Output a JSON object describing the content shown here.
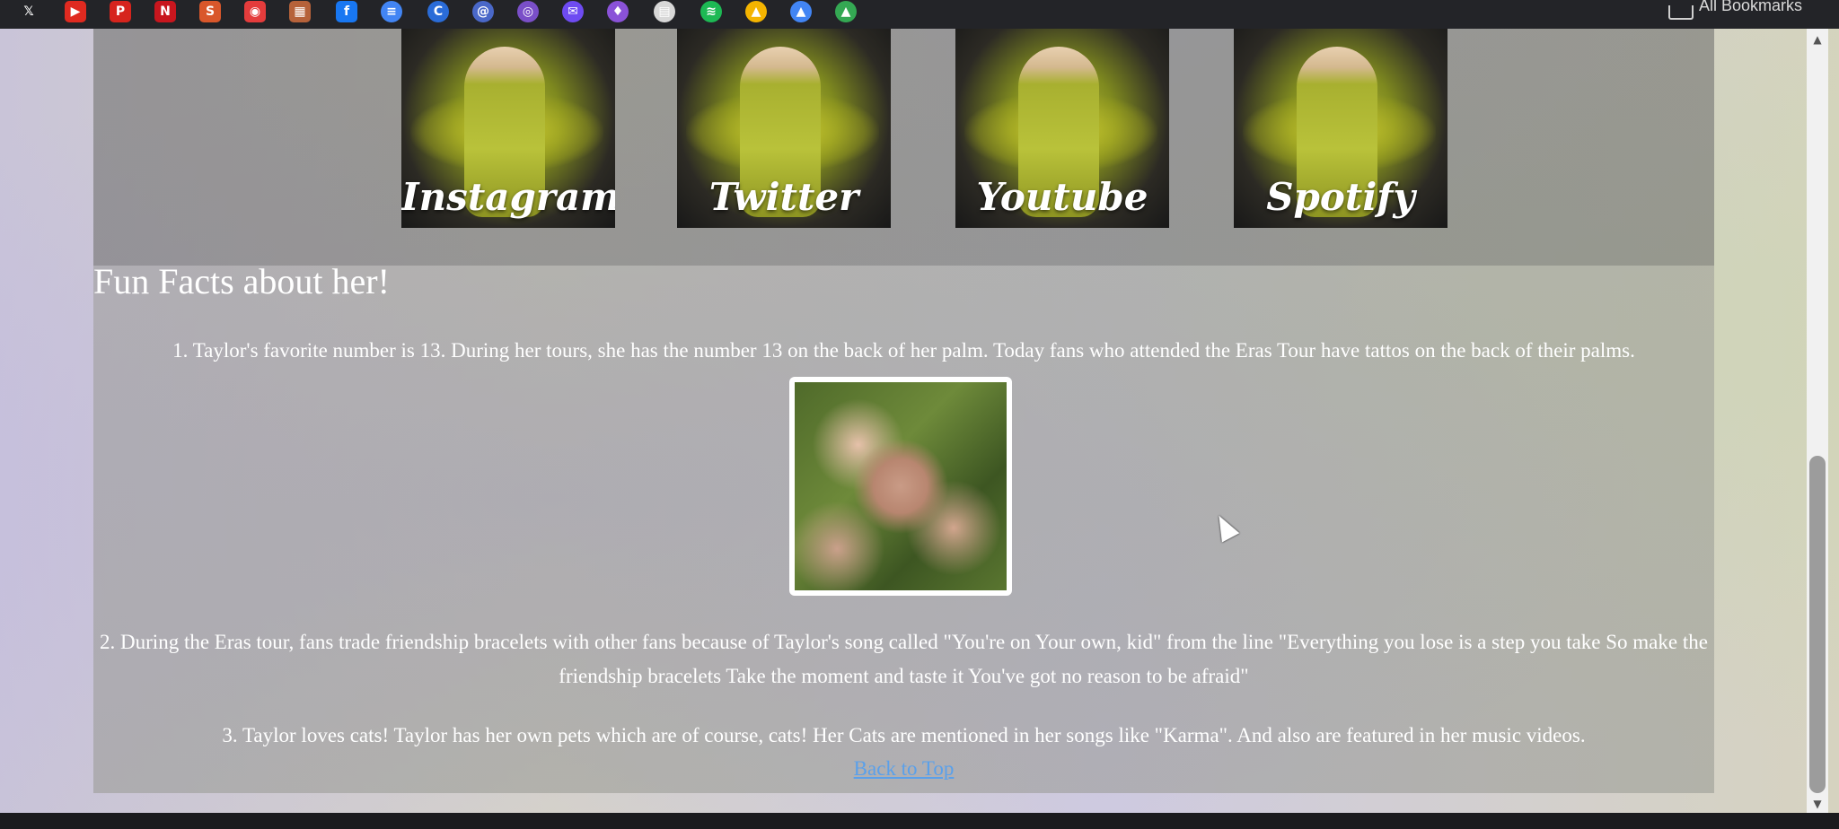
{
  "bookmarks": [
    {
      "icon": "x-icon",
      "glyph": "𝕏",
      "color": "#232428"
    },
    {
      "icon": "youtube-icon",
      "glyph": "▶",
      "color": "#e02a20"
    },
    {
      "icon": "pinterest-icon",
      "glyph": "P",
      "color": "#d6241d"
    },
    {
      "icon": "netflix-icon",
      "glyph": "N",
      "color": "#c8161e"
    },
    {
      "icon": "scribd-icon",
      "glyph": "S",
      "color": "#d9572b"
    },
    {
      "icon": "camera-icon",
      "glyph": "◉",
      "color": "#e43c3c"
    },
    {
      "icon": "gallery-icon",
      "glyph": "▦",
      "color": "#b6623a"
    },
    {
      "icon": "facebook-icon",
      "glyph": "f",
      "color": "#1877f2"
    },
    {
      "icon": "docs-icon",
      "glyph": "≡",
      "color": "#4285f4"
    },
    {
      "icon": "chrome-app-icon",
      "glyph": "C",
      "color": "#2a6cd8"
    },
    {
      "icon": "threads-icon",
      "glyph": "@",
      "color": "#4a68c8"
    },
    {
      "icon": "podcast-icon",
      "glyph": "◎",
      "color": "#7a4fc8"
    },
    {
      "icon": "messenger-icon",
      "glyph": "✉",
      "color": "#6e4bf2"
    },
    {
      "icon": "shield-icon",
      "glyph": "♦",
      "color": "#8a52d8"
    },
    {
      "icon": "sheet-icon",
      "glyph": "▤",
      "color": "#d8d8d8"
    },
    {
      "icon": "spotify-icon",
      "glyph": "≋",
      "color": "#1db954"
    },
    {
      "icon": "drive-icon",
      "glyph": "▲",
      "color": "#f4b400"
    },
    {
      "icon": "drive-icon-2",
      "glyph": "▲",
      "color": "#4285f4"
    },
    {
      "icon": "drive-icon-3",
      "glyph": "▲",
      "color": "#34a853"
    }
  ],
  "bookmarks_all_label": "All Bookmarks",
  "social": [
    {
      "label": "Instagram"
    },
    {
      "label": "Twitter"
    },
    {
      "label": "Youtube"
    },
    {
      "label": "Spotify"
    }
  ],
  "fun_facts_title": "Fun Facts about her!",
  "facts": [
    "1. Taylor's favorite number is 13. During her tours, she has the number 13 on the back of her palm. Today fans who attended the Eras Tour have tattos on the back of their palms.",
    "2. During the Eras tour, fans trade friendship bracelets with other fans because of Taylor's song called \"You're on Your own, kid\" from the line \"Everything you lose is a step you take So make the friendship bracelets Take the moment and taste it You've got no reason to be afraid\"",
    "3. Taylor loves cats! Taylor has her own pets which are of course, cats! Her Cats are mentioned in her songs like \"Karma\". And also are featured in her music videos."
  ],
  "back_to_top": "Back to Top",
  "scrollbar": {
    "up_glyph": "▲",
    "down_glyph": "▼"
  }
}
